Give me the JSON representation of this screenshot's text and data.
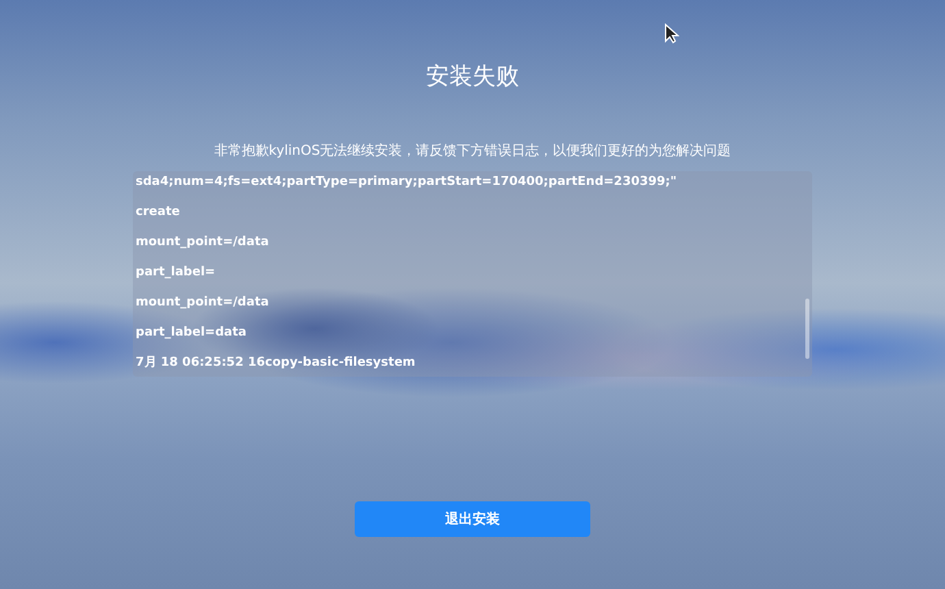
{
  "title": "安装失败",
  "message": "非常抱歉kylinOS无法继续安装，请反馈下方错误日志，以便我们更好的为您解决问题",
  "log_lines": [
    "sda4;num=4;fs=ext4;partType=primary;partStart=170400;partEnd=230399;\"",
    "create",
    "mount_point=/data",
    "part_label=",
    "mount_point=/data",
    "part_label=data",
    "7月 18 06:25:52 16copy-basic-filesystem"
  ],
  "button": "退出安装"
}
